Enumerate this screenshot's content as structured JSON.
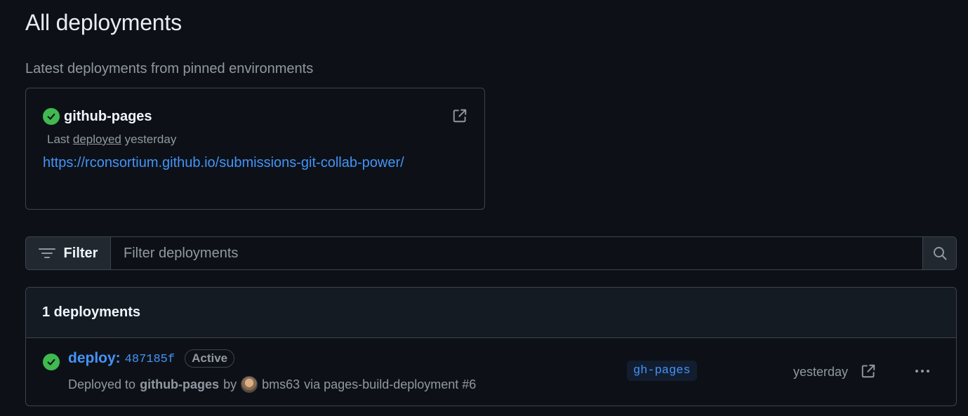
{
  "page": {
    "title": "All deployments"
  },
  "pinned": {
    "heading": "Latest deployments from pinned environments",
    "environment": {
      "name": "github-pages",
      "status_icon": "check-circle-icon",
      "last_prefix": "Last",
      "last_deployed_word": "deployed",
      "last_suffix": "yesterday",
      "url": "https://rconsortium.github.io/submissions-git-collab-power/"
    }
  },
  "filter": {
    "button_label": "Filter",
    "placeholder": "Filter deployments"
  },
  "deployments": {
    "count_label": "1 deployments",
    "items": [
      {
        "title": "deploy:",
        "sha": "487185f",
        "status": "Active",
        "deployed_to_prefix": "Deployed to",
        "environment": "github-pages",
        "by_word": "by",
        "user": "bms63",
        "via_text": "via pages-build-deployment #6",
        "ref": "gh-pages",
        "time": "yesterday"
      }
    ]
  },
  "colors": {
    "background": "#0d1117",
    "accent": "#4493f8",
    "success": "#3fb950",
    "muted": "#9198a1",
    "border": "#3d444d"
  }
}
